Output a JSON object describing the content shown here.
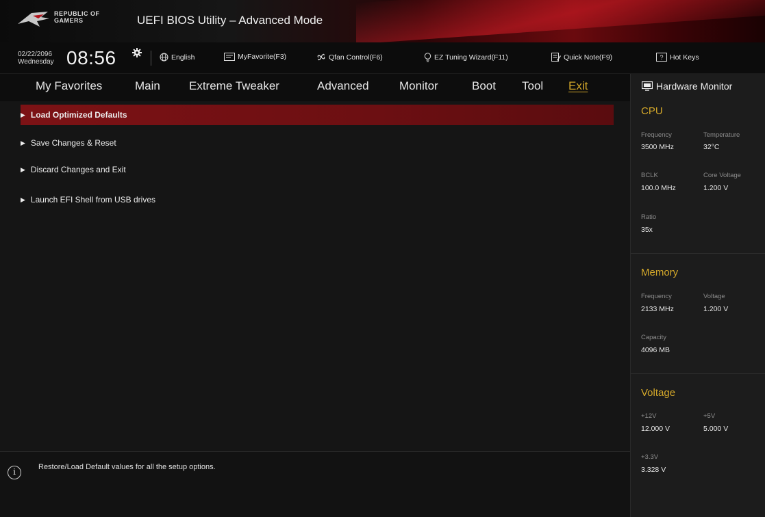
{
  "header": {
    "logo_text_line1": "REPUBLIC OF",
    "logo_text_line2": "GAMERS",
    "title": "UEFI BIOS Utility – Advanced Mode"
  },
  "toolbar": {
    "date": "02/22/2096",
    "weekday": "Wednesday",
    "time": "08:56",
    "items": [
      {
        "label": "English",
        "icon": "globe-icon"
      },
      {
        "label": "MyFavorite(F3)",
        "icon": "favorite-icon"
      },
      {
        "label": "Qfan Control(F6)",
        "icon": "fan-icon"
      },
      {
        "label": "EZ Tuning Wizard(F11)",
        "icon": "bulb-icon"
      },
      {
        "label": "Quick Note(F9)",
        "icon": "note-icon"
      },
      {
        "label": "Hot Keys",
        "icon": "hotkeys-icon"
      }
    ]
  },
  "tabs": [
    {
      "label": "My Favorites"
    },
    {
      "label": "Main"
    },
    {
      "label": "Extreme Tweaker"
    },
    {
      "label": "Advanced"
    },
    {
      "label": "Monitor"
    },
    {
      "label": "Boot"
    },
    {
      "label": "Tool"
    },
    {
      "label": "Exit",
      "active": true
    }
  ],
  "menu": [
    {
      "label": "Load Optimized Defaults",
      "selected": true
    },
    {
      "label": "Save Changes & Reset"
    },
    {
      "label": "Discard Changes and Exit"
    },
    {
      "label": "Launch EFI Shell from USB drives"
    }
  ],
  "help": {
    "text": "Restore/Load Default values for all the setup options."
  },
  "hardware_monitor": {
    "title": "Hardware Monitor",
    "cpu": {
      "heading": "CPU",
      "frequency_label": "Frequency",
      "frequency": "3500 MHz",
      "temperature_label": "Temperature",
      "temperature": "32°C",
      "bclk_label": "BCLK",
      "bclk": "100.0 MHz",
      "core_voltage_label": "Core Voltage",
      "core_voltage": "1.200 V",
      "ratio_label": "Ratio",
      "ratio": "35x"
    },
    "memory": {
      "heading": "Memory",
      "frequency_label": "Frequency",
      "frequency": "2133 MHz",
      "voltage_label": "Voltage",
      "voltage": "1.200 V",
      "capacity_label": "Capacity",
      "capacity": "4096 MB"
    },
    "voltage": {
      "heading": "Voltage",
      "v12_label": "+12V",
      "v12": "12.000 V",
      "v5_label": "+5V",
      "v5": "5.000 V",
      "v33_label": "+3.3V",
      "v33": "3.328 V"
    }
  },
  "colors": {
    "accent": "#d4a82a",
    "selection": "#7c1215",
    "header_red": "#6a0a0e"
  }
}
